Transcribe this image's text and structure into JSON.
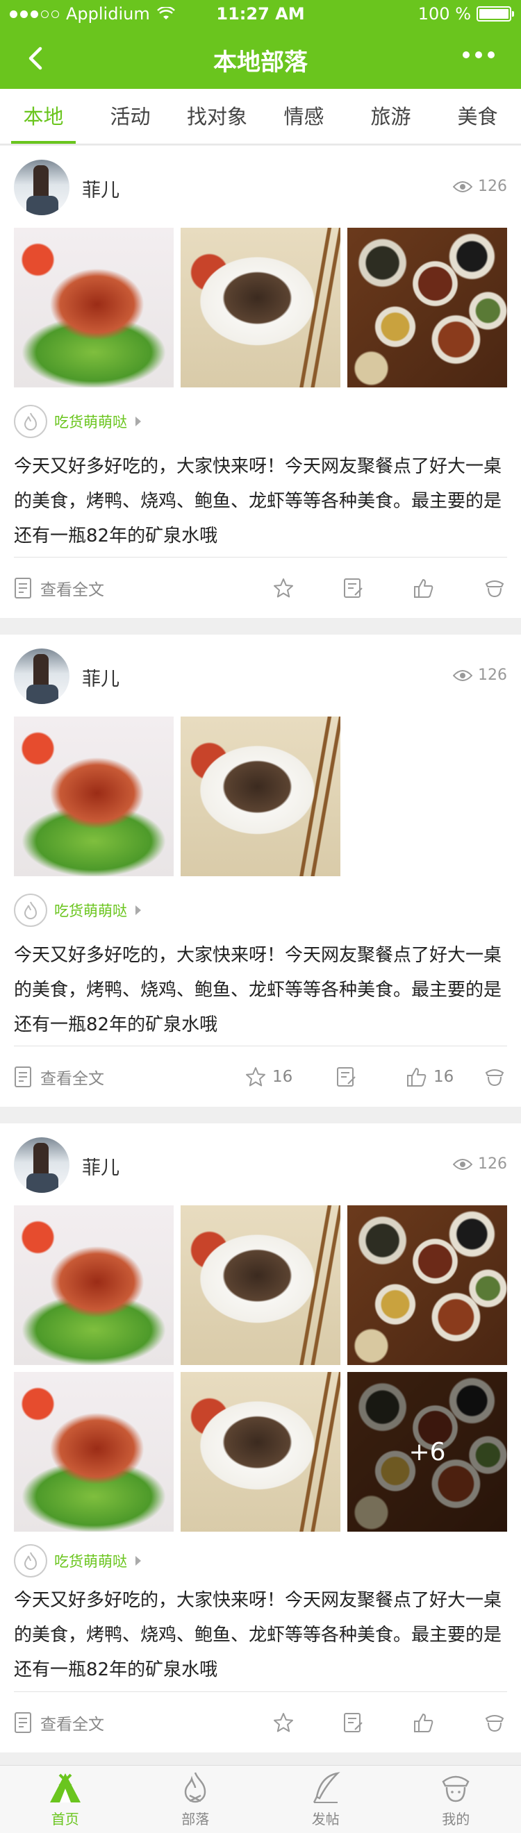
{
  "status": {
    "carrier": "Applidium",
    "time": "11:27 AM",
    "battery": "100 %"
  },
  "nav": {
    "title": "本地部落"
  },
  "tabs": [
    "本地",
    "活动",
    "找对象",
    "情感",
    "旅游",
    "美食"
  ],
  "posts": [
    {
      "user": "菲儿",
      "views": "126",
      "tag": "吃货萌萌哒",
      "content": "今天又好多好吃的，大家快来呀！今天网友聚餐点了好大一桌的美食，烤鸭、烧鸡、鲍鱼、龙虾等等各种美食。最主要的是还有一瓶82年的矿泉水哦",
      "read_more": "查看全文"
    },
    {
      "user": "菲儿",
      "views": "126",
      "tag": "吃货萌萌哒",
      "content": "今天又好多好吃的，大家快来呀！今天网友聚餐点了好大一桌的美食，烤鸭、烧鸡、鲍鱼、龙虾等等各种美食。最主要的是还有一瓶82年的矿泉水哦",
      "read_more": "查看全文",
      "favorites": "16",
      "likes": "16"
    },
    {
      "user": "菲儿",
      "views": "126",
      "tag": "吃货萌萌哒",
      "content": "今天又好多好吃的，大家快来呀！今天网友聚餐点了好大一桌的美食，烤鸭、烧鸡、鲍鱼、龙虾等等各种美食。最主要的是还有一瓶82年的矿泉水哦",
      "read_more": "查看全文",
      "more_photos": "+6"
    }
  ],
  "tabbar": [
    {
      "label": "首页",
      "icon": "home-icon"
    },
    {
      "label": "部落",
      "icon": "fire-icon"
    },
    {
      "label": "发帖",
      "icon": "quill-icon"
    },
    {
      "label": "我的",
      "icon": "profile-icon"
    }
  ],
  "colors": {
    "accent": "#6ac51e",
    "text": "#222222",
    "muted": "#888888"
  }
}
